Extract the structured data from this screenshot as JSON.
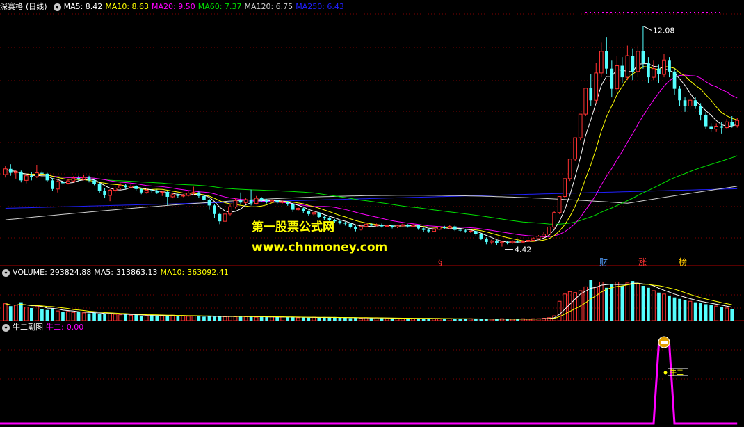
{
  "price_panel": {
    "stock_name": "深赛格",
    "period": "(日线)",
    "ma": [
      {
        "label": "MA5:",
        "value": "8.42",
        "color": "#ffffff"
      },
      {
        "label": "MA10:",
        "value": "8.63",
        "color": "#ffff00"
      },
      {
        "label": "MA20:",
        "value": "9.50",
        "color": "#ff00ff"
      },
      {
        "label": "MA60:",
        "value": "7.37",
        "color": "#00e000"
      },
      {
        "label": "MA120:",
        "value": "6.75",
        "color": "#d0d0d0"
      },
      {
        "label": "MA250:",
        "value": "6.43",
        "color": "#2020ff"
      }
    ],
    "high_label": "12.08",
    "low_label": "4.42",
    "markers": [
      "§",
      "财",
      "涨",
      "榜"
    ],
    "collapse_icon": "chevron-down-icon"
  },
  "volume_panel": {
    "title": "VOLUME:",
    "value": "293824.88",
    "ma5_label": "MA5:",
    "ma5_value": "313863.13",
    "ma10_label": "MA10:",
    "ma10_value": "363092.41"
  },
  "indicator_panel": {
    "title": "牛二副图",
    "series_label": "牛二:",
    "series_value": "0.00",
    "signal_text": "牛二"
  },
  "watermark": {
    "line1": "第一股票公式网",
    "line2": "www.chnmoney.com"
  },
  "colors": {
    "up": "#ff3232",
    "down": "#54ffff",
    "grid": "#800000",
    "indicator": "#ff00ff"
  },
  "chart_data": {
    "type": "candlestick",
    "price_high": 12.08,
    "price_low": 4.42,
    "candles": [
      [
        6.92,
        7.12,
        7.22,
        6.82
      ],
      [
        7.12,
        6.98,
        7.28,
        6.88
      ],
      [
        6.98,
        7.02,
        7.08,
        6.78
      ],
      [
        7.02,
        6.72,
        7.06,
        6.65
      ],
      [
        6.72,
        6.88,
        6.95,
        6.62
      ],
      [
        6.88,
        6.85,
        7.0,
        6.72
      ],
      [
        6.85,
        6.98,
        7.26,
        6.8
      ],
      [
        6.98,
        6.95,
        7.05,
        6.82
      ],
      [
        6.95,
        6.72,
        6.98,
        6.66
      ],
      [
        6.72,
        6.42,
        6.8,
        6.35
      ],
      [
        6.42,
        6.68,
        6.75,
        6.3
      ],
      [
        6.68,
        6.62,
        6.72,
        6.55
      ],
      [
        6.62,
        6.7,
        6.78,
        6.58
      ],
      [
        6.7,
        6.8,
        6.86,
        6.65
      ],
      [
        6.8,
        6.75,
        6.88,
        6.68
      ],
      [
        6.75,
        6.82,
        6.9,
        6.72
      ],
      [
        6.82,
        6.72,
        6.88,
        6.65
      ],
      [
        6.72,
        6.6,
        6.76,
        6.55
      ],
      [
        6.6,
        6.35,
        6.65,
        6.28
      ],
      [
        6.35,
        6.2,
        6.45,
        6.1
      ],
      [
        6.2,
        6.38,
        6.42,
        6.0
      ],
      [
        6.38,
        6.45,
        6.52,
        6.3
      ],
      [
        6.45,
        6.55,
        6.62,
        6.4
      ],
      [
        6.55,
        6.48,
        6.6,
        6.42
      ],
      [
        6.48,
        6.52,
        6.58,
        6.44
      ],
      [
        6.52,
        6.42,
        6.56,
        6.36
      ],
      [
        6.42,
        6.3,
        6.46,
        6.24
      ],
      [
        6.3,
        6.38,
        6.44,
        6.26
      ],
      [
        6.38,
        6.36,
        6.42,
        6.3
      ],
      [
        6.36,
        6.3,
        6.4,
        6.25
      ],
      [
        6.3,
        6.32,
        6.36,
        6.18
      ],
      [
        6.32,
        6.15,
        6.35,
        5.85
      ],
      [
        6.15,
        6.22,
        6.28,
        6.1
      ],
      [
        6.22,
        6.18,
        6.26,
        6.12
      ],
      [
        6.18,
        6.2,
        6.25,
        6.14
      ],
      [
        6.2,
        6.28,
        6.34,
        6.16
      ],
      [
        6.28,
        6.3,
        6.5,
        6.2
      ],
      [
        6.3,
        6.18,
        6.34,
        6.1
      ],
      [
        6.18,
        6.05,
        6.22,
        5.98
      ],
      [
        6.05,
        5.85,
        6.08,
        5.7
      ],
      [
        5.85,
        5.55,
        5.9,
        5.4
      ],
      [
        5.55,
        5.3,
        5.6,
        5.2
      ],
      [
        5.3,
        5.55,
        5.62,
        5.25
      ],
      [
        5.55,
        5.8,
        5.88,
        5.5
      ],
      [
        5.8,
        6.02,
        6.1,
        5.75
      ],
      [
        6.02,
        5.95,
        6.3,
        5.88
      ],
      [
        5.95,
        6.05,
        6.1,
        5.9
      ],
      [
        6.05,
        5.92,
        6.4,
        5.85
      ],
      [
        5.92,
        6.1,
        6.18,
        5.88
      ],
      [
        6.1,
        6.05,
        6.14,
        5.98
      ],
      [
        6.05,
        5.98,
        6.08,
        5.92
      ],
      [
        5.98,
        6.02,
        6.06,
        5.94
      ],
      [
        6.02,
        5.95,
        6.05,
        5.9
      ],
      [
        5.95,
        5.98,
        6.02,
        5.92
      ],
      [
        5.98,
        5.9,
        6.0,
        5.84
      ],
      [
        5.9,
        5.7,
        5.94,
        5.62
      ],
      [
        5.7,
        5.75,
        5.8,
        5.65
      ],
      [
        5.75,
        5.65,
        5.78,
        5.58
      ],
      [
        5.65,
        5.55,
        5.68,
        5.5
      ],
      [
        5.55,
        5.6,
        5.64,
        5.48
      ],
      [
        5.6,
        5.45,
        5.62,
        5.4
      ],
      [
        5.45,
        5.4,
        5.5,
        5.35
      ],
      [
        5.4,
        5.35,
        5.45,
        5.3
      ],
      [
        5.35,
        5.3,
        5.38,
        5.24
      ],
      [
        5.3,
        5.25,
        5.35,
        5.2
      ],
      [
        5.25,
        5.22,
        5.28,
        5.15
      ],
      [
        5.22,
        5.1,
        5.25,
        5.05
      ],
      [
        5.1,
        5.02,
        5.15,
        4.95
      ],
      [
        5.02,
        5.12,
        5.16,
        4.98
      ],
      [
        5.12,
        5.2,
        5.26,
        5.08
      ],
      [
        5.2,
        5.15,
        5.24,
        5.1
      ],
      [
        5.15,
        5.18,
        5.22,
        5.12
      ],
      [
        5.18,
        5.12,
        5.22,
        5.08
      ],
      [
        5.12,
        5.15,
        5.18,
        5.1
      ],
      [
        5.15,
        5.1,
        5.18,
        5.05
      ],
      [
        5.1,
        5.14,
        5.18,
        5.06
      ],
      [
        5.14,
        5.18,
        5.22,
        5.1
      ],
      [
        5.18,
        5.12,
        5.2,
        5.08
      ],
      [
        5.12,
        5.16,
        5.2,
        5.1
      ],
      [
        5.16,
        5.05,
        5.18,
        5.0
      ],
      [
        5.05,
        5.0,
        5.08,
        4.92
      ],
      [
        5.0,
        4.95,
        5.04,
        4.9
      ],
      [
        4.95,
        5.02,
        5.06,
        4.92
      ],
      [
        5.02,
        5.1,
        5.14,
        4.98
      ],
      [
        5.1,
        5.06,
        5.14,
        5.02
      ],
      [
        5.06,
        5.12,
        5.16,
        5.02
      ],
      [
        5.12,
        5.0,
        5.15,
        4.96
      ],
      [
        5.0,
        4.98,
        5.04,
        4.94
      ],
      [
        4.98,
        4.95,
        5.02,
        4.9
      ],
      [
        4.95,
        4.96,
        5.0,
        4.9
      ],
      [
        4.96,
        4.85,
        4.98,
        4.8
      ],
      [
        4.85,
        4.7,
        4.88,
        4.65
      ],
      [
        4.7,
        4.58,
        4.74,
        4.5
      ],
      [
        4.58,
        4.62,
        4.66,
        4.5
      ],
      [
        4.62,
        4.55,
        4.66,
        4.48
      ],
      [
        4.55,
        4.58,
        4.62,
        4.42
      ],
      [
        4.58,
        4.56,
        4.62,
        4.5
      ],
      [
        4.56,
        4.6,
        4.64,
        4.52
      ],
      [
        4.6,
        4.58,
        4.64,
        4.54
      ],
      [
        4.58,
        4.6,
        4.64,
        4.54
      ],
      [
        4.6,
        4.64,
        4.68,
        4.56
      ],
      [
        4.64,
        4.7,
        4.75,
        4.6
      ],
      [
        4.7,
        4.78,
        4.82,
        4.66
      ],
      [
        4.78,
        4.85,
        4.92,
        4.72
      ],
      [
        4.85,
        5.1,
        5.14,
        4.8
      ],
      [
        5.1,
        5.6,
        5.64,
        5.05
      ],
      [
        5.6,
        6.16,
        6.16,
        5.55
      ],
      [
        6.16,
        6.78,
        6.78,
        6.1
      ],
      [
        6.78,
        7.46,
        7.46,
        6.7
      ],
      [
        7.46,
        8.2,
        8.2,
        7.4
      ],
      [
        8.2,
        9.02,
        9.02,
        8.1
      ],
      [
        9.02,
        9.92,
        9.92,
        8.95
      ],
      [
        9.92,
        9.5,
        10.4,
        9.3
      ],
      [
        9.5,
        10.45,
        10.8,
        9.4
      ],
      [
        10.45,
        11.2,
        11.5,
        10.3
      ],
      [
        11.2,
        10.6,
        11.7,
        10.4
      ],
      [
        10.6,
        9.9,
        10.9,
        9.6
      ],
      [
        9.9,
        10.7,
        11.05,
        9.8
      ],
      [
        10.7,
        10.3,
        11.0,
        10.1
      ],
      [
        10.3,
        11.05,
        11.4,
        10.2
      ],
      [
        11.05,
        10.5,
        11.3,
        10.2
      ],
      [
        10.5,
        11.2,
        11.4,
        10.3
      ],
      [
        11.2,
        10.8,
        12.08,
        10.6
      ],
      [
        10.8,
        10.3,
        11.0,
        10.1
      ],
      [
        10.3,
        10.6,
        10.9,
        10.2
      ],
      [
        10.6,
        10.4,
        10.75,
        10.1
      ],
      [
        10.4,
        10.9,
        11.1,
        10.3
      ],
      [
        10.9,
        10.5,
        11.0,
        10.3
      ],
      [
        10.5,
        9.9,
        10.6,
        9.7
      ],
      [
        9.9,
        9.5,
        10.0,
        9.3
      ],
      [
        9.5,
        9.3,
        9.6,
        9.1
      ],
      [
        9.3,
        9.5,
        9.7,
        9.2
      ],
      [
        9.5,
        9.3,
        9.6,
        9.2
      ],
      [
        9.3,
        9.0,
        9.4,
        8.8
      ],
      [
        9.0,
        8.6,
        9.1,
        8.5
      ],
      [
        8.6,
        8.5,
        8.7,
        8.4
      ],
      [
        8.5,
        8.6,
        8.7,
        8.4
      ],
      [
        8.6,
        8.55,
        8.75,
        8.35
      ],
      [
        8.55,
        8.75,
        8.85,
        8.5
      ],
      [
        8.75,
        8.62,
        8.95,
        8.55
      ],
      [
        8.62,
        8.8,
        8.9,
        8.55
      ]
    ],
    "volume": [
      35,
      30,
      32,
      38,
      28,
      26,
      30,
      24,
      22,
      25,
      20,
      18,
      19,
      17,
      18,
      16,
      15,
      16,
      14,
      13,
      14,
      13,
      12,
      13,
      11,
      12,
      10,
      11,
      12,
      10,
      11,
      10,
      11,
      9,
      10,
      9,
      10,
      9,
      8,
      9,
      8,
      9,
      8,
      9,
      8,
      9,
      8,
      8,
      7,
      8,
      7,
      8,
      7,
      8,
      7,
      7,
      6,
      7,
      6,
      7,
      6,
      7,
      6,
      7,
      6,
      6,
      5,
      6,
      5,
      6,
      5,
      6,
      5,
      5,
      4,
      5,
      4,
      5,
      4,
      5,
      4,
      5,
      4,
      4,
      3,
      4,
      3,
      4,
      3,
      4,
      3,
      4,
      3,
      3,
      3,
      4,
      3,
      3,
      3,
      4,
      3,
      4,
      4,
      5,
      6,
      10,
      40,
      55,
      60,
      58,
      62,
      70,
      85,
      70,
      80,
      68,
      75,
      80,
      72,
      78,
      82,
      76,
      72,
      68,
      62,
      58,
      55,
      52,
      48,
      45,
      42,
      40,
      38,
      36,
      34,
      32,
      30,
      28,
      26,
      24
    ],
    "indicator": {
      "name": "牛二",
      "value": 0.0,
      "spike_days": [
        125,
        126,
        127
      ],
      "spike_level": 1.0
    }
  }
}
